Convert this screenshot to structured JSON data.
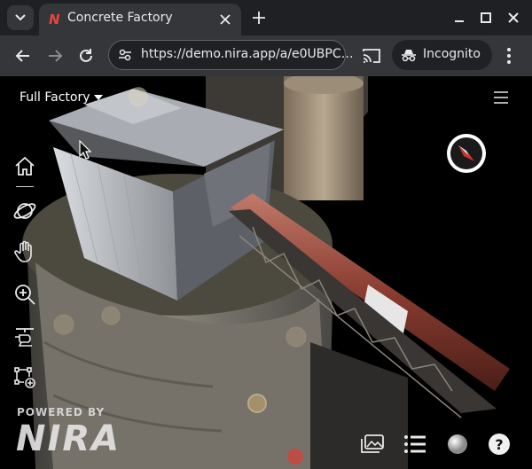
{
  "browser": {
    "tab_title": "Concrete Factory",
    "url": "https://demo.nira.app/a/e0UBPC…",
    "incognito_label": "Incognito",
    "favicon_letter": "N",
    "accent_color": "#e8453c"
  },
  "viewer": {
    "scene_selector": "Full Factory",
    "powered_by": "POWERED BY",
    "brand": "NIRA",
    "left_tools": [
      "home-icon",
      "orbit-icon",
      "pan-hand-icon",
      "zoom-icon",
      "helicopter-icon",
      "measure-icon"
    ],
    "bottom_tools": [
      "gallery-icon",
      "list-icon",
      "material-sphere-icon",
      "help-icon"
    ],
    "help_glyph": "?"
  }
}
